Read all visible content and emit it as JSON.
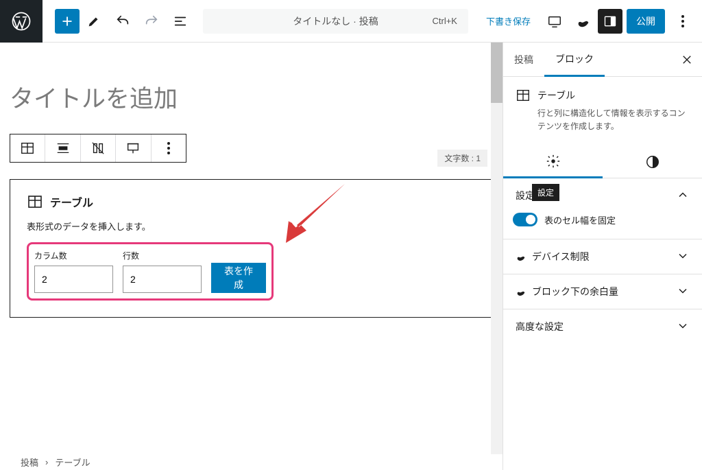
{
  "topbar": {
    "doc_title": "タイトルなし · 投稿",
    "shortcut": "Ctrl+K",
    "draft_save": "下書き保存",
    "publish": "公開"
  },
  "editor": {
    "title_placeholder": "タイトルを追加",
    "word_count": "文字数 : 1",
    "table_block": {
      "name": "テーブル",
      "subtitle": "表形式のデータを挿入します。",
      "columns_label": "カラム数",
      "rows_label": "行数",
      "columns_value": "2",
      "rows_value": "2",
      "create_button": "表を作成"
    }
  },
  "breadcrumb": {
    "root": "投稿",
    "sep": "›",
    "leaf": "テーブル"
  },
  "sidebar": {
    "tab_post": "投稿",
    "tab_block": "ブロック",
    "block_name": "テーブル",
    "block_desc": "行と列に構造化して情報を表示するコンテンツを作成します。",
    "settings_label": "設定",
    "settings_tooltip": "設定",
    "fixed_width": "表のセル幅を固定",
    "device_limit": "デバイス制限",
    "margin_bottom": "ブロック下の余白量",
    "advanced": "高度な設定"
  }
}
